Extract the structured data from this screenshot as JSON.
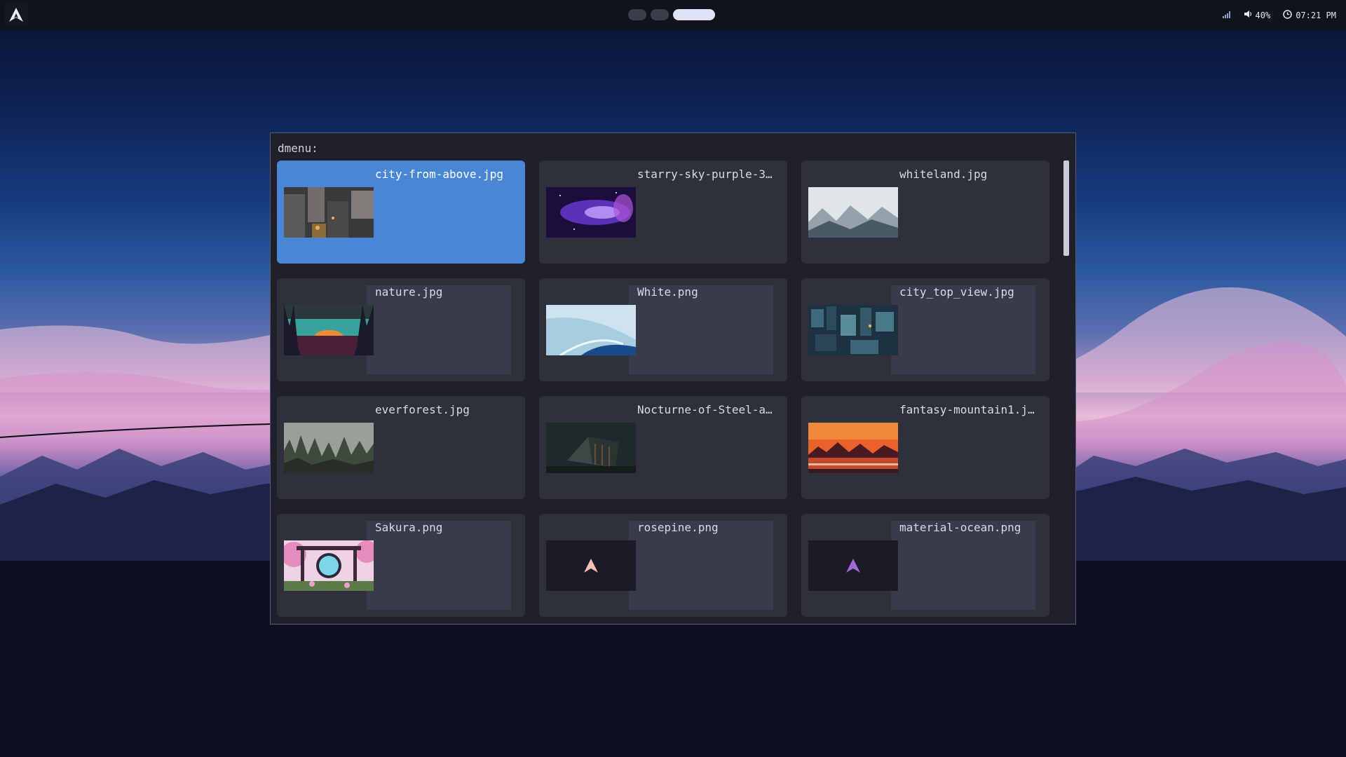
{
  "topbar": {
    "logo_icon": "arch-linux-logo-icon",
    "workspaces": [
      {
        "state": "inactive"
      },
      {
        "state": "inactive"
      },
      {
        "state": "active"
      }
    ],
    "tray": {
      "signal_icon": "signal-icon",
      "volume_icon": "volume-icon",
      "volume": "40%",
      "clock_icon": "clock-icon",
      "time": "07:21 PM"
    }
  },
  "dmenu": {
    "prompt": "dmenu:",
    "selected_index": 0,
    "items": [
      {
        "name": "city-from-above.jpg",
        "thumb": "city-from-above"
      },
      {
        "name": "starry-sky-purple-3…",
        "thumb": "starry-sky"
      },
      {
        "name": "whiteland.jpg",
        "thumb": "whiteland"
      },
      {
        "name": "nature.jpg",
        "thumb": "nature"
      },
      {
        "name": "White.png",
        "thumb": "white"
      },
      {
        "name": "city_top_view.jpg",
        "thumb": "city-top-view"
      },
      {
        "name": "everforest.jpg",
        "thumb": "everforest"
      },
      {
        "name": "Nocturne-of-Steel-a…",
        "thumb": "nocturne"
      },
      {
        "name": "fantasy-mountain1.j…",
        "thumb": "fantasy-mountain"
      },
      {
        "name": "Sakura.png",
        "thumb": "sakura"
      },
      {
        "name": "rosepine.png",
        "thumb": "rosepine"
      },
      {
        "name": "material-ocean.png",
        "thumb": "material-ocean"
      }
    ]
  },
  "colors": {
    "selection": "#4a86d6",
    "card": "#2e303c",
    "window": "#1f2029",
    "topbar": "#11131c"
  }
}
